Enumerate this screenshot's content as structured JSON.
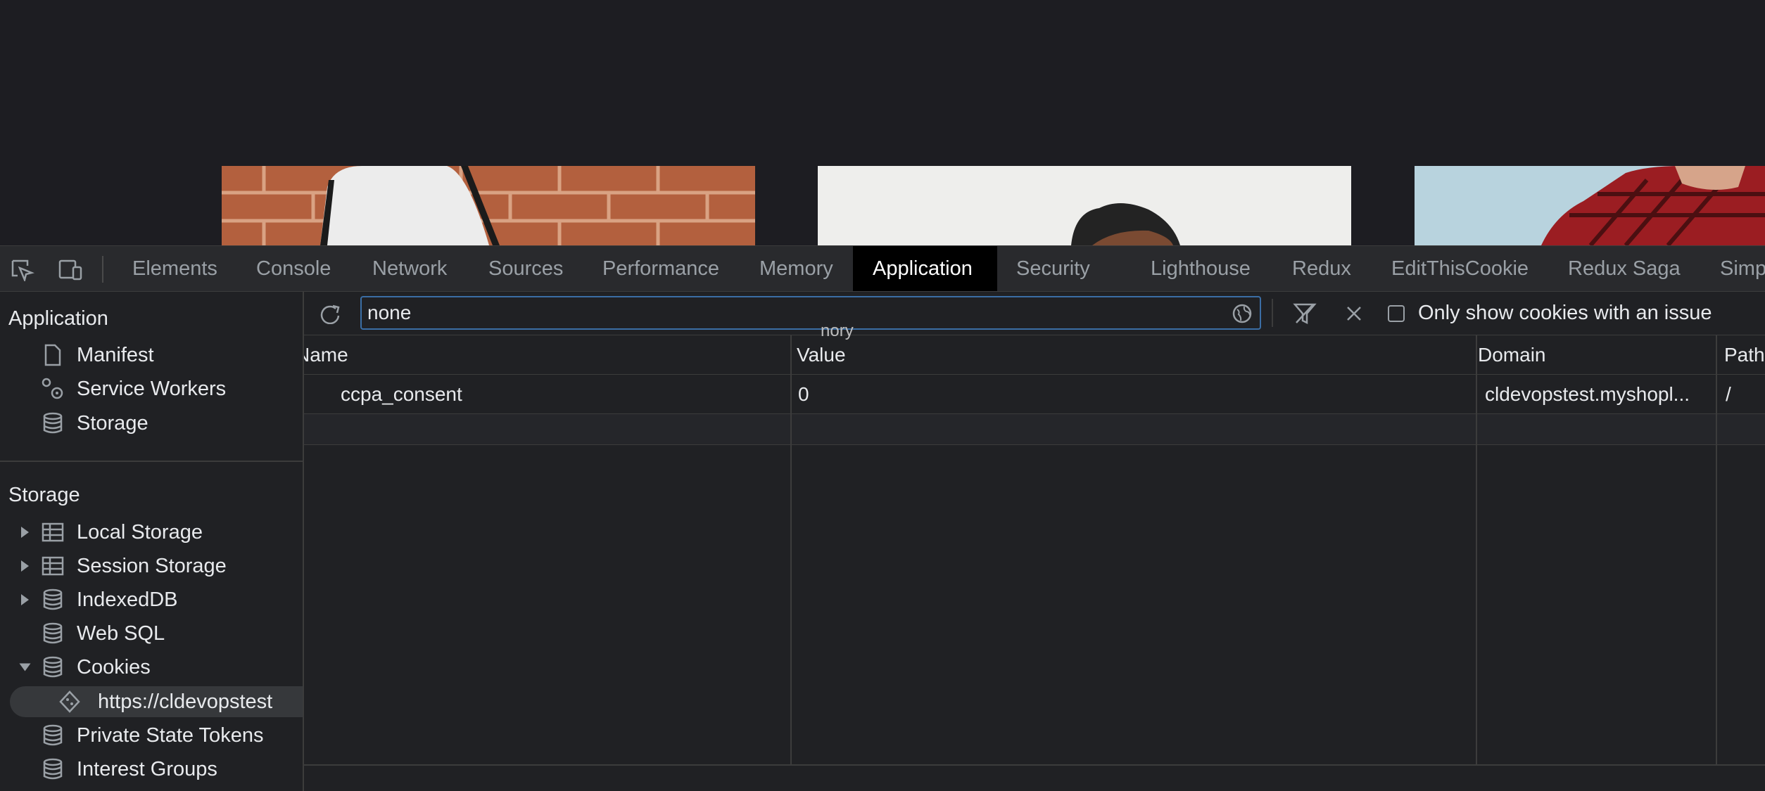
{
  "devtools_tabs": [
    {
      "label": "Elements",
      "active": false
    },
    {
      "label": "Console",
      "active": false
    },
    {
      "label": "Network",
      "active": false
    },
    {
      "label": "Sources",
      "active": false
    },
    {
      "label": "Performance",
      "active": false
    },
    {
      "label": "Memory",
      "active": false
    },
    {
      "label": "Application",
      "active": true
    },
    {
      "label": "Security",
      "active": false
    },
    {
      "label": "Lighthouse",
      "active": false
    },
    {
      "label": "Redux",
      "active": false
    },
    {
      "label": "EditThisCookie",
      "active": false
    },
    {
      "label": "Redux Saga",
      "active": false
    },
    {
      "label": "Simp",
      "active": false
    }
  ],
  "sidebar": {
    "application_heading": "Application",
    "application_items": [
      {
        "label": "Manifest",
        "icon": "document-icon"
      },
      {
        "label": "Service Workers",
        "icon": "gears-icon"
      },
      {
        "label": "Storage",
        "icon": "database-icon"
      }
    ],
    "storage_heading": "Storage",
    "storage_items": [
      {
        "label": "Local Storage",
        "icon": "grid-icon",
        "expandable": true
      },
      {
        "label": "Session Storage",
        "icon": "grid-icon",
        "expandable": true
      },
      {
        "label": "IndexedDB",
        "icon": "database-icon",
        "expandable": true
      },
      {
        "label": "Web SQL",
        "icon": "database-icon",
        "expandable": false
      },
      {
        "label": "Cookies",
        "icon": "database-icon",
        "expandable": true
      },
      {
        "label": "https://cldevopstest",
        "icon": "cookie-icon",
        "expandable": false,
        "selected": true
      },
      {
        "label": "Private State Tokens",
        "icon": "database-icon",
        "expandable": false
      },
      {
        "label": "Interest Groups",
        "icon": "database-icon",
        "expandable": false
      }
    ]
  },
  "toolbar": {
    "filter_value": "none",
    "ghost_text": "nory",
    "only_issue_label": "Only show cookies with an issue"
  },
  "cookies_table": {
    "columns": [
      "Name",
      "Value",
      "Domain",
      "Path"
    ],
    "rows": [
      {
        "name": "ccpa_consent",
        "value": "0",
        "domain": "cldevopstest.myshopl...",
        "path": "/"
      }
    ]
  },
  "colors": {
    "devtools_bg": "#202124",
    "tabbar_bg": "#292a2d",
    "active_tab_bg": "#000000",
    "filter_border": "#3b6ea5"
  }
}
